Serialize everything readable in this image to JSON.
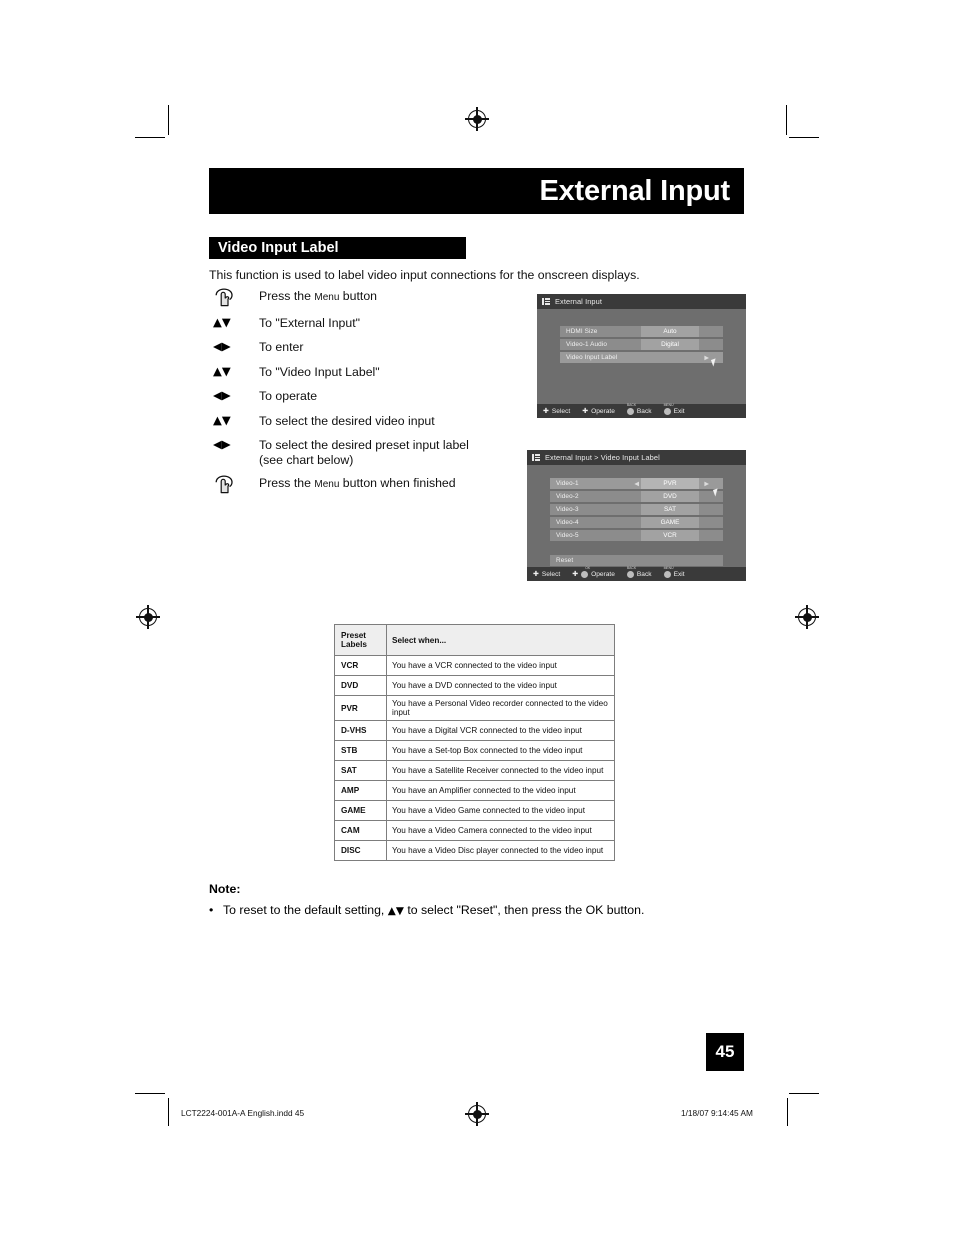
{
  "page": {
    "title": "External Input",
    "section_heading": "Video Input Label",
    "intro": "This function is used to label video input connections for the onscreen displays.",
    "page_number": "45"
  },
  "steps": [
    {
      "icon": "hand-press-icon",
      "text_before": "Press the ",
      "smallcaps": "Menu",
      "text_after": " button"
    },
    {
      "icon": "up-down-arrows-icon",
      "arrows": "▲▼",
      "text": "To \"External Input\""
    },
    {
      "icon": "left-right-arrows-icon",
      "arrows": "◀▶",
      "text": "To enter"
    },
    {
      "icon": "up-down-arrows-icon",
      "arrows": "▲▼",
      "text": "To \"Video Input Label\""
    },
    {
      "icon": "left-right-arrows-icon",
      "arrows": "◀▶",
      "text": "To operate"
    },
    {
      "icon": "up-down-arrows-icon",
      "arrows": "▲▼",
      "text": "To select the desired video input"
    },
    {
      "icon": "left-right-arrows-icon",
      "arrows": "◀▶",
      "text": "To select the desired preset input label (see chart below)"
    },
    {
      "icon": "hand-press-icon",
      "text_before": "Press the ",
      "smallcaps": "Menu",
      "text_after": " button when finished"
    }
  ],
  "osd1": {
    "title": "External Input",
    "rows": [
      {
        "label": "HDMI Size",
        "value": "Auto",
        "selected": false
      },
      {
        "label": "Video-1 Audio",
        "value": "Digital",
        "selected": false
      },
      {
        "label": "Video Input Label",
        "value": "",
        "selected": true,
        "arrow_right": "▶"
      }
    ],
    "bottom": [
      {
        "label": "Select",
        "control": "dpad",
        "mini": ""
      },
      {
        "label": "Operate",
        "control": "dpad",
        "mini": ""
      },
      {
        "label": "Back",
        "control": "dot",
        "mini": "BACK"
      },
      {
        "label": "Exit",
        "control": "dot",
        "mini": "MENU"
      }
    ]
  },
  "osd2": {
    "title": "External Input > Video Input Label",
    "rows": [
      {
        "label": "Video-1",
        "value": "PVR",
        "selected": true,
        "arrow_left": "◀",
        "arrow_right": "▶"
      },
      {
        "label": "Video-2",
        "value": "DVD",
        "selected": false
      },
      {
        "label": "Video-3",
        "value": "SAT",
        "selected": false
      },
      {
        "label": "Video-4",
        "value": "GAME",
        "selected": false
      },
      {
        "label": "Video-5",
        "value": "VCR",
        "selected": false
      }
    ],
    "reset_label": "Reset",
    "bottom": [
      {
        "label": "Select",
        "control": "dpad",
        "mini": ""
      },
      {
        "label": "Operate",
        "control": "dpad-dot",
        "mini": "OK"
      },
      {
        "label": "Back",
        "control": "dot",
        "mini": "BACK"
      },
      {
        "label": "Exit",
        "control": "dot",
        "mini": "MENU"
      }
    ]
  },
  "preset_table": {
    "headers": [
      "Preset Labels",
      "Select when..."
    ],
    "header_line1": "Preset",
    "header_line2": "Labels",
    "rows": [
      {
        "label": "VCR",
        "desc": "You have a VCR connected to the video input"
      },
      {
        "label": "DVD",
        "desc": "You have a DVD connected to the video input"
      },
      {
        "label": "PVR",
        "desc": "You have a Personal Video recorder connected to the video input"
      },
      {
        "label": "D-VHS",
        "desc": "You have a Digital VCR connected to the video input"
      },
      {
        "label": "STB",
        "desc": "You have a Set-top Box connected to the video input"
      },
      {
        "label": "SAT",
        "desc": "You have a Satellite Receiver connected to the video input"
      },
      {
        "label": "AMP",
        "desc": "You have an Amplifier connected to the video input"
      },
      {
        "label": "GAME",
        "desc": "You have a Video Game connected to the video input"
      },
      {
        "label": "CAM",
        "desc": "You have a Video Camera connected to the video input"
      },
      {
        "label": "DISC",
        "desc": "You have a Video Disc player connected to the video input"
      }
    ]
  },
  "note": {
    "heading": "Note:",
    "bullet": "•",
    "text_before": "To reset to the default setting,",
    "arrows": "▲▼",
    "text_after": "to select \"Reset\", then press the OK button."
  },
  "footer": {
    "file": "LCT2224-001A-A English.indd   45",
    "timestamp": "1/18/07   9:14:45 AM"
  },
  "colors": {
    "accent_black": "#000000",
    "osd_bg": "#6e6e6e",
    "osd_bar": "#3a3a3a",
    "osd_row": "#8c8c8c",
    "osd_value": "#a2a2a2"
  }
}
